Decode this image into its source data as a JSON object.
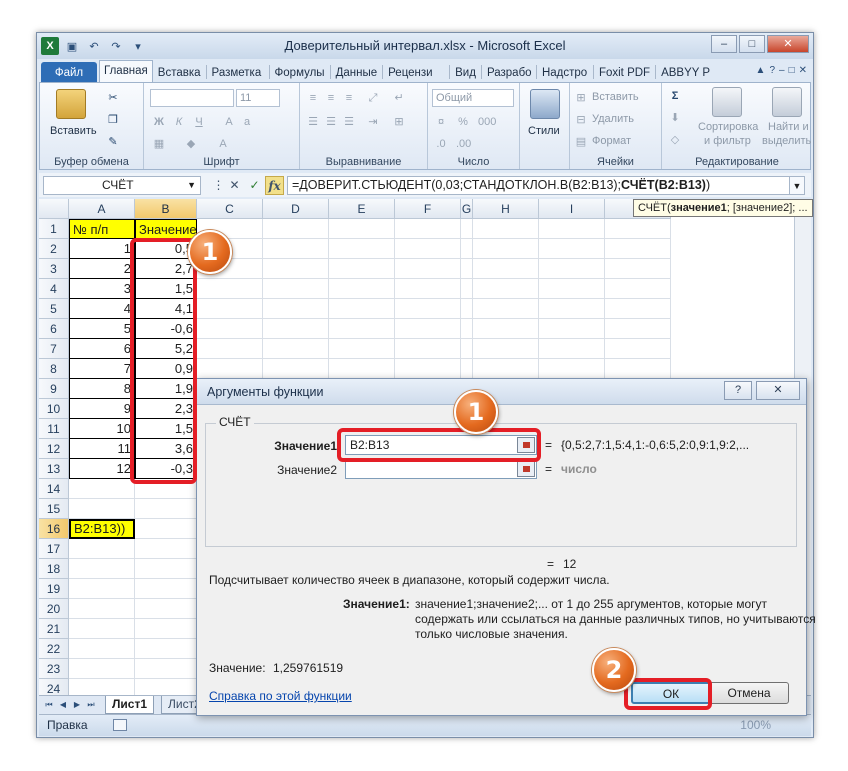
{
  "window": {
    "title": "Доверительный интервал.xlsx - Microsoft Excel",
    "minimize": "–",
    "maximize": "□",
    "close": "✕"
  },
  "quick_access": [
    "save-icon",
    "undo-icon",
    "redo-icon",
    "customize-icon"
  ],
  "ribbon_tabs": [
    "Файл",
    "Главная",
    "Вставка",
    "Разметка",
    "Формулы",
    "Данные",
    "Рецензи",
    "Вид",
    "Разрабо",
    "Надстро",
    "Foxit PDF",
    "ABBYY PD"
  ],
  "ribbon": {
    "clipboard": {
      "paste": "Вставить",
      "label": "Буфер обмена"
    },
    "font": {
      "size": "11",
      "label": "Шрифт"
    },
    "alignment": {
      "label": "Выравнивание"
    },
    "number": {
      "format": "Общий",
      "label": "Число"
    },
    "styles": {
      "button": "Стили"
    },
    "cells": {
      "insert": "Вставить",
      "delete": "Удалить",
      "format": "Формат",
      "label": "Ячейки"
    },
    "editing": {
      "sort_line1": "Сортировка",
      "sort_line2": "и фильтр",
      "find_line1": "Найти и",
      "find_line2": "выделить",
      "label": "Редактирование"
    }
  },
  "formula_bar": {
    "name_box": "СЧЁТ",
    "fx": "fx",
    "formula_normal": "=ДОВЕРИТ.СТЬЮДЕНТ(0,03;СТАНДОТКЛОН.В(B2:B13);",
    "formula_bold": "СЧЁТ(B2:B13)",
    "formula_tail": ")",
    "tooltip_bold": "СЧЁТ(",
    "tooltip_arg1": "значение1",
    "tooltip_rest": "; [значение2]; ..."
  },
  "columns": [
    "A",
    "B",
    "C",
    "D",
    "E",
    "F",
    "G",
    "H",
    "I",
    "J"
  ],
  "rows": [
    "1",
    "2",
    "3",
    "4",
    "5",
    "6",
    "7",
    "8",
    "9",
    "10",
    "11",
    "12",
    "13",
    "14",
    "15",
    "16",
    "17",
    "18",
    "19",
    "20",
    "21",
    "22",
    "23",
    "24"
  ],
  "table": {
    "header_a": "№ п/п",
    "header_b": "Значение",
    "index": [
      "1",
      "2",
      "3",
      "4",
      "5",
      "6",
      "7",
      "8",
      "9",
      "10",
      "11",
      "12"
    ],
    "values": [
      "0,5",
      "2,7",
      "1,5",
      "4,1",
      "-0,6",
      "5,2",
      "0,9",
      "1,9",
      "2,3",
      "1,5",
      "3,6",
      "-0,3"
    ],
    "active_cell_text": "B2:B13))"
  },
  "sheet_tabs": [
    "Лист1",
    "Лист2"
  ],
  "status": {
    "mode": "Правка",
    "zoom": "100%"
  },
  "dialog": {
    "title": "Аргументы функции",
    "help": "?",
    "close": "✕",
    "function_name": "СЧЁТ",
    "arg1_label": "Значение1",
    "arg1_value": "B2:B13",
    "arg1_result": "{0,5:2,7:1,5:4,1:-0,6:5,2:0,9:1,9:2,...",
    "arg2_label": "Значение2",
    "arg2_value": "",
    "arg2_result": "число",
    "equals": "=",
    "result": "12",
    "description": "Подсчитывает количество ячеек в диапазоне, который содержит числа.",
    "arg_desc_label": "Значение1:",
    "arg_desc_line1": "значение1;значение2;... от 1 до 255 аргументов, которые могут",
    "arg_desc_line2": "содержать или ссылаться на данные различных типов, но учитываются",
    "arg_desc_line3": "только числовые значения.",
    "value_label": "Значение:",
    "value": "1,259761519",
    "help_link": "Справка по этой функции",
    "ok": "ОК",
    "cancel": "Отмена"
  },
  "callouts": {
    "badge_1": "1",
    "badge_2": "2"
  },
  "colors": {
    "highlight": "#ffff00",
    "callout": "#e41e26",
    "badge": "#e46a1f",
    "file_tab": "#2e6db6"
  }
}
